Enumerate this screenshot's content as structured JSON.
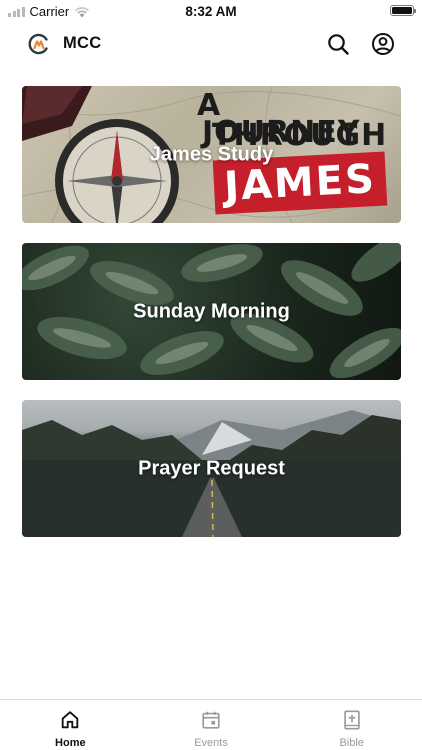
{
  "status_bar": {
    "carrier": "Carrier",
    "time": "8:32 AM"
  },
  "header": {
    "title": "MCC",
    "logo_icon": "mcc-logo",
    "search_icon": "search-icon",
    "account_icon": "account-icon"
  },
  "cards": [
    {
      "label": "James Study",
      "image_text": [
        "A",
        "JOURNEY",
        "THROUGH",
        "JAMES"
      ]
    },
    {
      "label": "Sunday Morning"
    },
    {
      "label": "Prayer Request"
    }
  ],
  "tabs": [
    {
      "label": "Home",
      "icon": "home-icon",
      "active": true
    },
    {
      "label": "Events",
      "icon": "calendar-icon",
      "active": false
    },
    {
      "label": "Bible",
      "icon": "bible-icon",
      "active": false
    }
  ],
  "colors": {
    "accent": "#c61f2c",
    "logo_orange": "#f0832a",
    "active_tab": "#111111",
    "inactive_tab": "#9a9a9a"
  }
}
